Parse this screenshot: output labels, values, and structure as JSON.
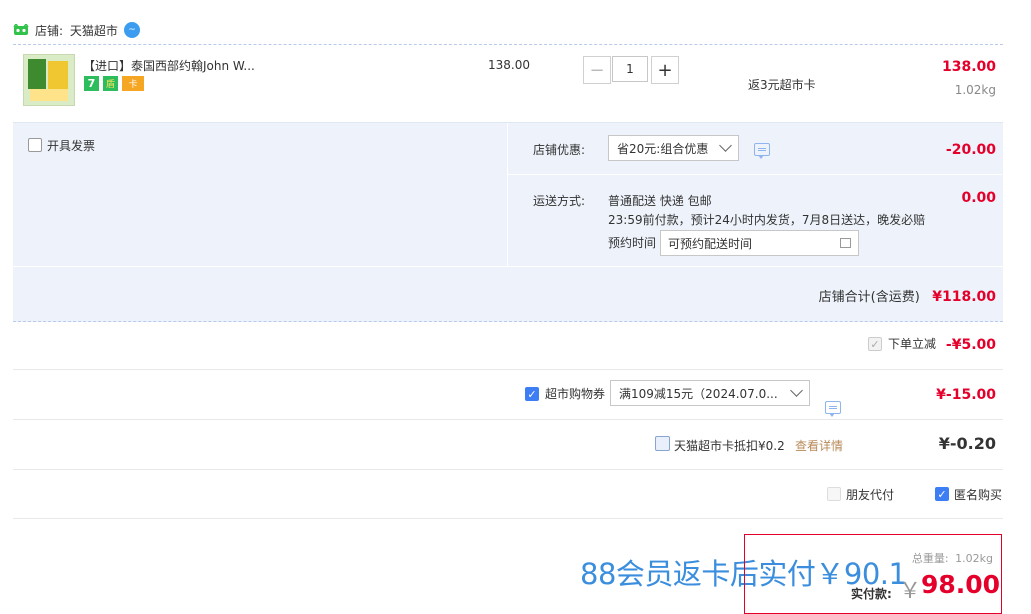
{
  "shop": {
    "prefix": "店铺:",
    "name": "天猫超市"
  },
  "item": {
    "title": "【进口】泰国西部约翰John W...",
    "unit_price": "138.00",
    "quantity": "1",
    "rebate": "返3元超市卡",
    "subtotal": "138.00",
    "weight": "1.02kg",
    "tags": [
      "7",
      "盾",
      "卡"
    ]
  },
  "invoice": {
    "label": "开具发票"
  },
  "discount": {
    "label": "店铺优惠:",
    "selected": "省20元:组合优惠",
    "amount": "-20.00"
  },
  "delivery": {
    "label": "运送方式:",
    "method": "普通配送 快递 包邮",
    "note": "23:59前付款，预计24小时内发货，7月8日送达，晚发必赔",
    "amount": "0.00",
    "reserve_label": "预约时间",
    "reserve_placeholder": "可预约配送时间"
  },
  "shop_total": {
    "label": "店铺合计(含运费)",
    "amount": "¥118.00"
  },
  "instant": {
    "label": "下单立减",
    "amount": "-¥5.00"
  },
  "coupon": {
    "label": "超市购物券",
    "selected": "满109减15元（2024.07.0...",
    "amount": "¥-15.00"
  },
  "card": {
    "label": "天猫超市卡抵扣¥0.2",
    "link": "查看详情",
    "amount": "¥-0.20"
  },
  "options": {
    "friend_pay": "朋友代付",
    "anonymous": "匿名购买"
  },
  "summary": {
    "promo": "88会员返卡后实付￥90.1",
    "weight_label": "总重量:",
    "weight": "1.02kg",
    "pay_label": "实付款:",
    "currency": "￥",
    "pay_amount": "98.00"
  },
  "colors": {
    "accent": "#3d7ef5",
    "price": "#e4002b",
    "promo": "#3b8ede",
    "panel": "#eef3fb"
  }
}
